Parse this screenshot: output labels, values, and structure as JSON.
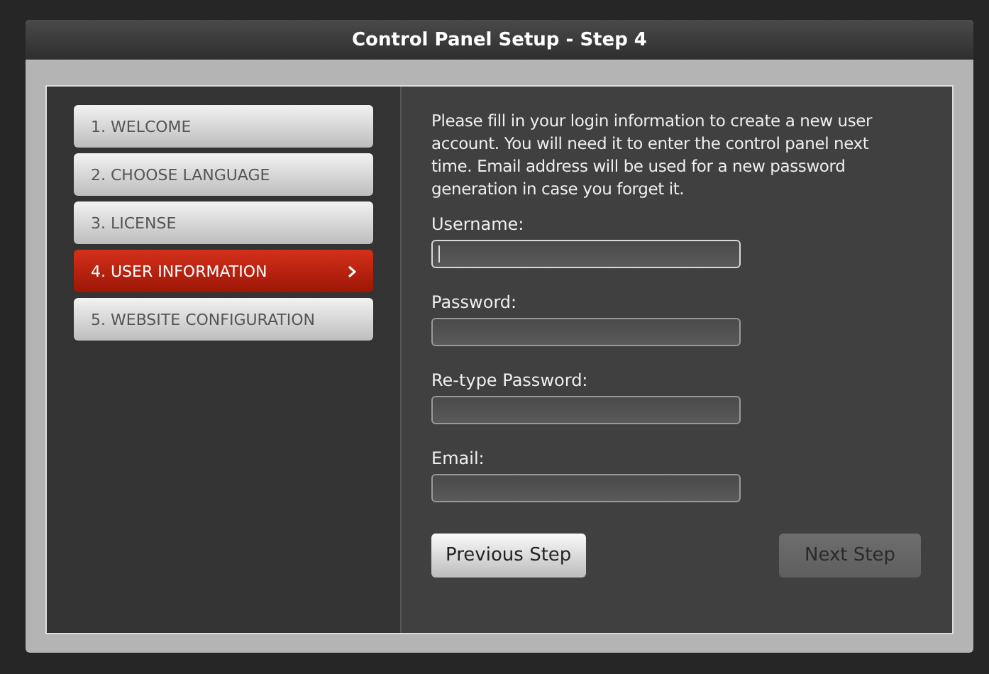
{
  "window": {
    "title": "Control Panel Setup - Step 4"
  },
  "steps": [
    {
      "label": "1. WELCOME",
      "selected": false
    },
    {
      "label": "2. CHOOSE LANGUAGE",
      "selected": false
    },
    {
      "label": "3. LICENSE",
      "selected": false
    },
    {
      "label": "4. USER INFORMATION",
      "selected": true
    },
    {
      "label": "5. WEBSITE CONFIGURATION",
      "selected": false
    }
  ],
  "intro": "Please fill in your login information to create a new user account. You will need it to enter the control panel next time. Email address will be used for a new password generation in case you forget it.",
  "fields": [
    {
      "label": "Username:",
      "focused": true
    },
    {
      "label": "Password:",
      "focused": false
    },
    {
      "label": "Re-type Password:",
      "focused": false
    },
    {
      "label": "Email:",
      "focused": false
    }
  ],
  "buttons": [
    {
      "label": "Previous Step",
      "disabled": false
    },
    {
      "label": "Next Step",
      "disabled": true
    }
  ]
}
